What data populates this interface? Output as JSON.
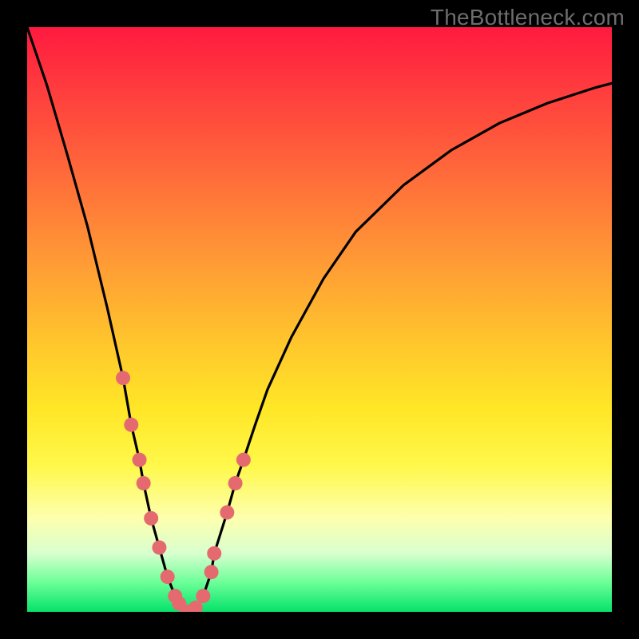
{
  "watermark": {
    "text": "TheBottleneck.com"
  },
  "colors": {
    "frame_background": "#000000",
    "gradient_top": "#ff1a3f",
    "gradient_bottom": "#06e26b",
    "curve_stroke": "#000000",
    "marker_fill": "#e46a6f"
  },
  "chart_data": {
    "type": "line",
    "title": "",
    "xlabel": "",
    "ylabel": "",
    "xlim": [
      0,
      100
    ],
    "ylim": [
      0,
      100
    ],
    "grid": false,
    "series": [
      {
        "name": "bottleneck-curve",
        "x": [
          0,
          3.4,
          6.8,
          10.3,
          13.7,
          16.4,
          17.8,
          19.2,
          19.9,
          21.2,
          22.6,
          24.0,
          25.3,
          26.0,
          27.4,
          28.1,
          28.8,
          30.1,
          31.5,
          32.0,
          34.2,
          35.6,
          37.0,
          39.0,
          41.1,
          45.2,
          50.7,
          56.2,
          64.4,
          72.6,
          80.8,
          89.0,
          97.3,
          100.0
        ],
        "y": [
          100,
          90.0,
          78.4,
          66.0,
          52.0,
          40.0,
          32.0,
          26.0,
          22.0,
          16.0,
          11.0,
          6.0,
          2.7,
          1.4,
          0.0,
          0.0,
          0.7,
          2.7,
          6.8,
          10.0,
          17.0,
          22.0,
          26.0,
          32.0,
          38.0,
          47.0,
          57.0,
          65.0,
          73.0,
          79.0,
          83.6,
          87.0,
          89.7,
          90.4
        ]
      }
    ],
    "markers": {
      "name": "highlight-dots",
      "x": [
        16.4,
        17.8,
        19.2,
        19.9,
        21.2,
        22.6,
        24.0,
        25.3,
        26.0,
        27.4,
        28.1,
        28.8,
        30.1,
        31.5,
        32.0,
        34.2,
        35.6,
        37.0
      ],
      "y": [
        40.0,
        32.0,
        26.0,
        22.0,
        16.0,
        11.0,
        6.0,
        2.7,
        1.4,
        0.0,
        0.0,
        0.7,
        2.7,
        6.8,
        10.0,
        17.0,
        22.0,
        26.0
      ]
    }
  }
}
